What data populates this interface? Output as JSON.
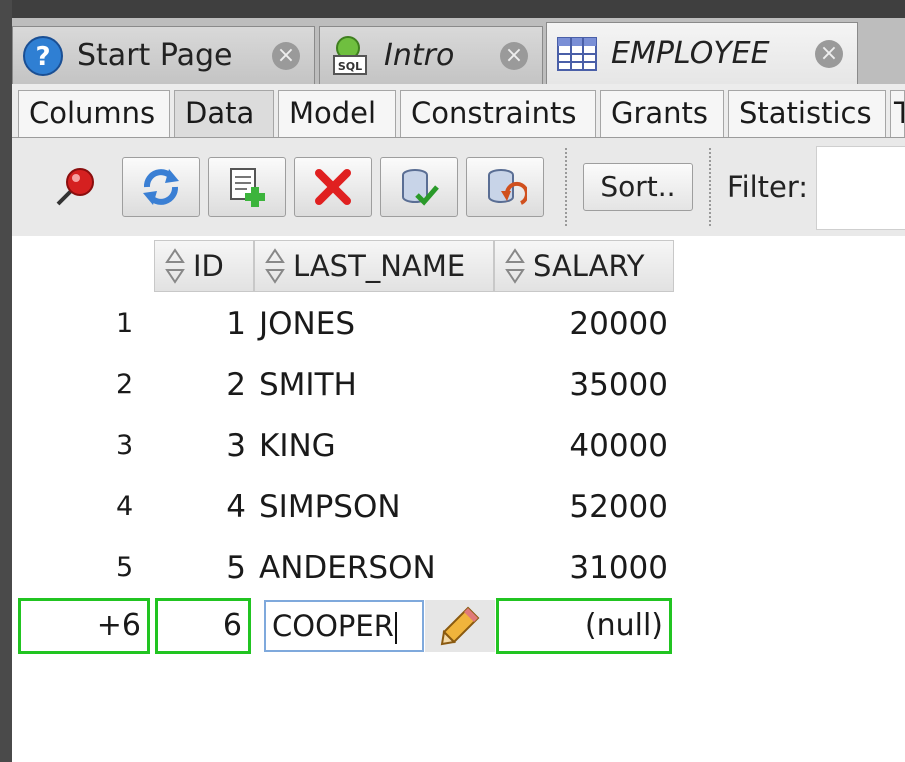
{
  "doc_tabs": [
    {
      "label": "Start Page",
      "icon": "help-icon",
      "close": "×"
    },
    {
      "label": "Intro",
      "icon": "sql-worksheet-icon",
      "close": "×"
    },
    {
      "label": "EMPLOYEE",
      "icon": "table-icon",
      "close": "×"
    }
  ],
  "sub_tabs": [
    {
      "label": "Columns"
    },
    {
      "label": "Data"
    },
    {
      "label": "Model"
    },
    {
      "label": "Constraints"
    },
    {
      "label": "Grants"
    },
    {
      "label": "Statistics"
    },
    {
      "label": "T"
    }
  ],
  "toolbar": {
    "buttons": [
      "pin-icon",
      "refresh-icon",
      "insert-row-icon",
      "delete-row-icon",
      "commit-icon",
      "rollback-icon"
    ],
    "sort_label": "Sort..",
    "filter_label": "Filter:",
    "filter_value": ""
  },
  "grid": {
    "columns": [
      "ID",
      "LAST_NAME",
      "SALARY"
    ],
    "rows": [
      {
        "num": "1",
        "id": "1",
        "last_name": "JONES",
        "salary": "20000"
      },
      {
        "num": "2",
        "id": "2",
        "last_name": "SMITH",
        "salary": "35000"
      },
      {
        "num": "3",
        "id": "3",
        "last_name": "KING",
        "salary": "40000"
      },
      {
        "num": "4",
        "id": "4",
        "last_name": "SIMPSON",
        "salary": "52000"
      },
      {
        "num": "5",
        "id": "5",
        "last_name": "ANDERSON",
        "salary": "31000"
      }
    ],
    "new_row": {
      "num": "+6",
      "id": "6",
      "last_name": "COOPER",
      "salary": "(null)"
    }
  },
  "colors": {
    "new_row_border": "#21c421",
    "edit_border": "#7fa9dc",
    "delete": "#e02020",
    "refresh": "#3a7fd4"
  }
}
